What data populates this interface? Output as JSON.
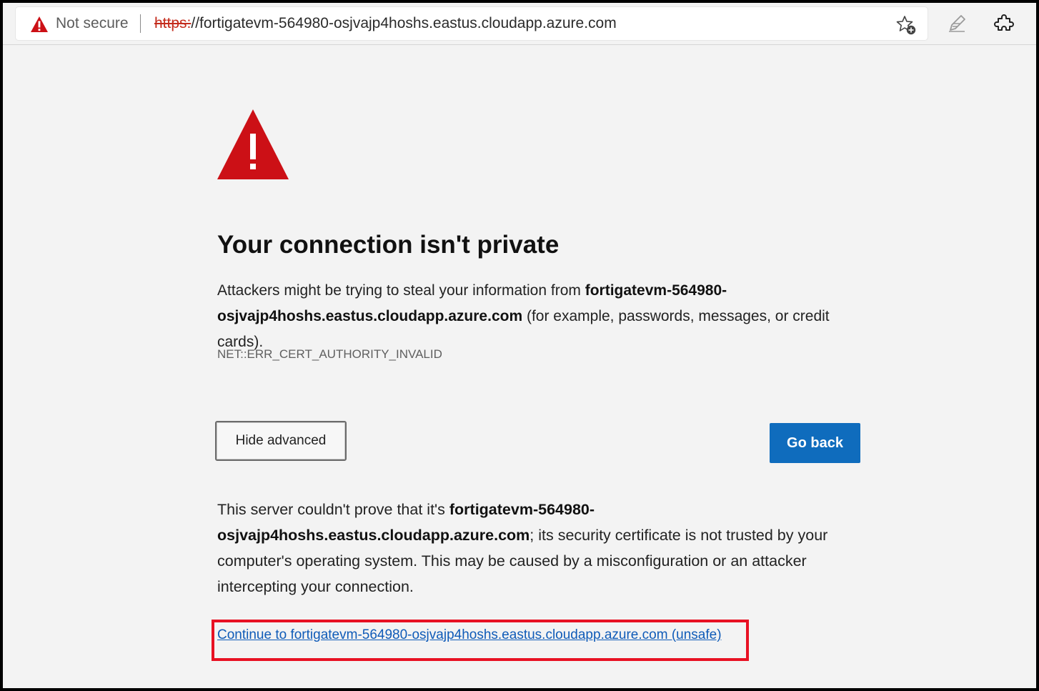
{
  "browser": {
    "security_label": "Not secure",
    "url_scheme": "https:",
    "url_rest": "//fortigatevm-564980-osjvajp4hoshs.eastus.cloudapp.azure.com",
    "icons": [
      "warning-icon",
      "add-favorite-icon",
      "pen-icon",
      "extensions-icon"
    ]
  },
  "page": {
    "heading": "Your connection isn't private",
    "desc_prefix": "Attackers might be trying to steal your information from ",
    "desc_host": "fortigatevm-564980-osjvajp4hoshs.eastus.cloudapp.azure.com",
    "desc_suffix": " (for example, passwords, messages, or credit cards).",
    "error_code": "NET::ERR_CERT_AUTHORITY_INVALID",
    "hide_advanced_label": "Hide advanced",
    "go_back_label": "Go back",
    "explain_prefix": "This server couldn't prove that it's ",
    "explain_host": "fortigatevm-564980-osjvajp4hoshs.eastus.cloudapp.azure.com",
    "explain_suffix": "; its security certificate is not trusted by your computer's operating system. This may be caused by a misconfiguration or an attacker intercepting your connection.",
    "proceed_link": "Continue to fortigatevm-564980-osjvajp4hoshs.eastus.cloudapp.azure.com (unsafe)"
  },
  "colors": {
    "warning_red": "#cc1016",
    "go_back_blue": "#0f6cbd",
    "highlight_box": "#e81123"
  }
}
